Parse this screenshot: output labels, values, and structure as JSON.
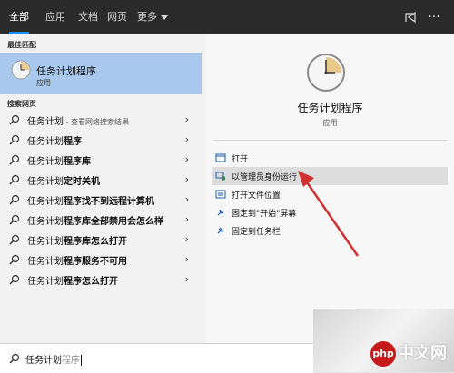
{
  "tabs": [
    {
      "label": "全部",
      "active": true
    },
    {
      "label": "应用",
      "active": false
    },
    {
      "label": "文档",
      "active": false
    },
    {
      "label": "网页",
      "active": false
    },
    {
      "label": "更多",
      "active": false
    }
  ],
  "left": {
    "best_match_header": "最佳匹配",
    "best_match": {
      "title": "任务计划程序",
      "subtitle": "应用"
    },
    "web_header": "搜索网页",
    "web_items": [
      {
        "normal": "任务计划",
        "bold": "",
        "small": " - 查看网络搜索结果"
      },
      {
        "normal": "任务计划",
        "bold": "程序",
        "small": ""
      },
      {
        "normal": "任务计划",
        "bold": "程序库",
        "small": ""
      },
      {
        "normal": "任务计划",
        "bold": "定时关机",
        "small": ""
      },
      {
        "normal": "任务计划",
        "bold": "程序找不到远程计算机",
        "small": ""
      },
      {
        "normal": "任务计划",
        "bold": "程序库全部禁用会怎么样",
        "small": ""
      },
      {
        "normal": "任务计划",
        "bold": "程序库怎么打开",
        "small": ""
      },
      {
        "normal": "任务计划",
        "bold": "程序服务不可用",
        "small": ""
      },
      {
        "normal": "任务计划",
        "bold": "程序怎么打开",
        "small": ""
      }
    ]
  },
  "right": {
    "app_title": "任务计划程序",
    "app_type": "应用",
    "actions": [
      {
        "label": "打开",
        "icon": "open-icon"
      },
      {
        "label": "以管理员身份运行",
        "icon": "run-as-admin-icon"
      },
      {
        "label": "打开文件位置",
        "icon": "file-location-icon"
      },
      {
        "label": "固定到\"开始\"屏幕",
        "icon": "pin-start-icon"
      },
      {
        "label": "固定到任务栏",
        "icon": "pin-taskbar-icon"
      }
    ]
  },
  "search": {
    "typed": "任务计划",
    "completion": "程序"
  },
  "watermark": {
    "badge": "php",
    "text": "中文网"
  },
  "colors": {
    "accent": "#1e90ff",
    "selected": "#a8c8ee",
    "arrow": "#d03030"
  }
}
